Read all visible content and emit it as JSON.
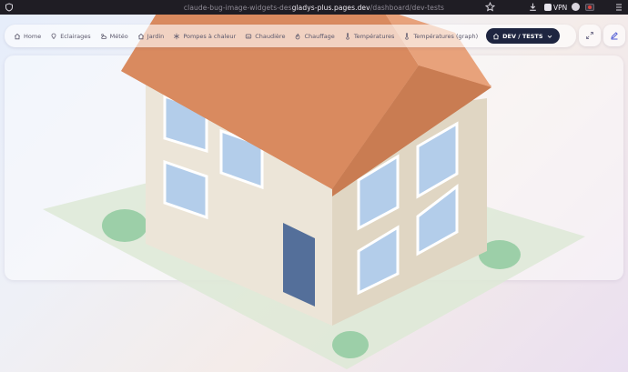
{
  "browser": {
    "url_prefix": "claude-bug-image-widgets-des",
    "url_host": "gladys-plus.pages.dev",
    "url_path": "/dashboard/dev-tests",
    "vpn_label": "VPN"
  },
  "nav": {
    "items": [
      {
        "label": "Home",
        "icon": "home-icon"
      },
      {
        "label": "Eclairages",
        "icon": "lightbulb-icon"
      },
      {
        "label": "Météo",
        "icon": "cloud-sun-icon"
      },
      {
        "label": "Jardin",
        "icon": "home-icon"
      },
      {
        "label": "Pompes à chaleur",
        "icon": "snowflake-icon"
      },
      {
        "label": "Chaudière",
        "icon": "boiler-icon"
      },
      {
        "label": "Chauffage",
        "icon": "flame-icon"
      },
      {
        "label": "Températures",
        "icon": "thermometer-icon"
      },
      {
        "label": "Températures (graph)",
        "icon": "thermometer-icon"
      }
    ],
    "active": {
      "label": "DEV / TESTS",
      "icon": "home-icon"
    }
  },
  "actions": {
    "fullscreen_icon": "expand-icon",
    "edit_icon": "edit-icon"
  },
  "colors": {
    "active_nav": "#1e2540",
    "edit_accent": "#4f5bd5",
    "roof": "#d98a5f",
    "wall": "#e7dfcf",
    "window": "#b3cdea",
    "door": "#546f9a",
    "lawn": "#dde9d6",
    "bush": "#8fca9f"
  }
}
